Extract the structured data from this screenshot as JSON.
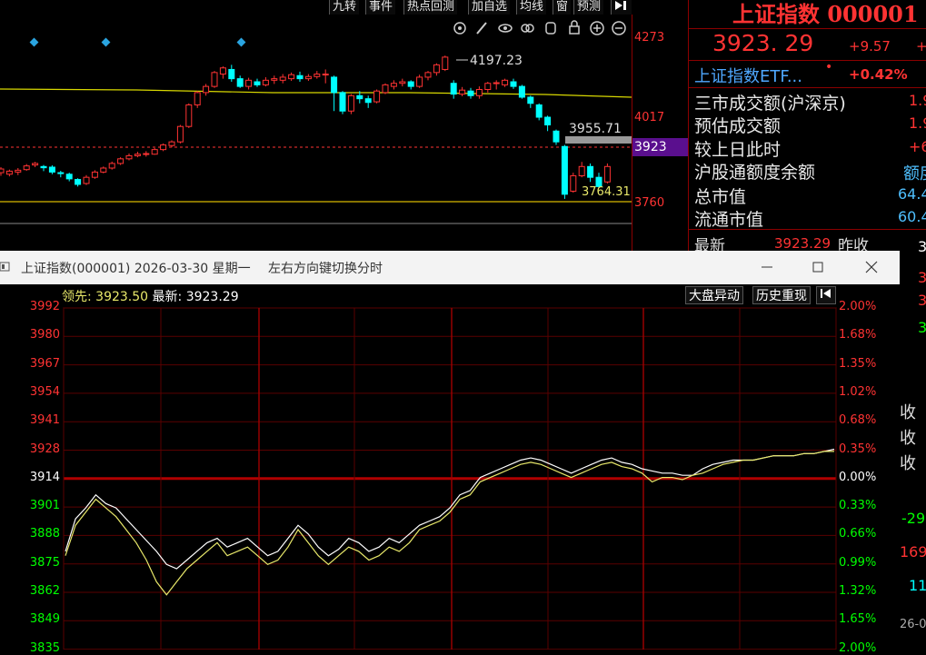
{
  "toolbar": {
    "items": [
      "九转",
      "事件",
      "热点回测",
      "加自选",
      "均线",
      "窗",
      "预测"
    ]
  },
  "kline": {
    "high_label": "4197.23",
    "low_label": "3764.31",
    "recent_label": "3955.71",
    "axis_labels": [
      "4273",
      "4017",
      "3760"
    ],
    "current_axis": "3923",
    "candles": [
      [
        3860,
        3872,
        3850,
        3878
      ],
      [
        3855,
        3865,
        3848,
        3870
      ],
      [
        3862,
        3868,
        3852,
        3875
      ],
      [
        3870,
        3882,
        3866,
        3888
      ],
      [
        3885,
        3890,
        3878,
        3895
      ],
      [
        3880,
        3876,
        3865,
        3885
      ],
      [
        3878,
        3862,
        3855,
        3884
      ],
      [
        3860,
        3858,
        3845,
        3866
      ],
      [
        3855,
        3840,
        3832,
        3860
      ],
      [
        3838,
        3822,
        3815,
        3842
      ],
      [
        3825,
        3845,
        3820,
        3852
      ],
      [
        3845,
        3862,
        3840,
        3868
      ],
      [
        3862,
        3875,
        3858,
        3880
      ],
      [
        3875,
        3890,
        3870,
        3896
      ],
      [
        3890,
        3905,
        3885,
        3910
      ],
      [
        3905,
        3915,
        3900,
        3922
      ],
      [
        3915,
        3920,
        3910,
        3928
      ],
      [
        3920,
        3922,
        3912,
        3930
      ],
      [
        3920,
        3935,
        3918,
        3940
      ],
      [
        3935,
        3950,
        3930,
        3955
      ],
      [
        3948,
        3960,
        3942,
        3965
      ],
      [
        3960,
        4010,
        3955,
        4015
      ],
      [
        4010,
        4080,
        4005,
        4085
      ],
      [
        4080,
        4120,
        4070,
        4125
      ],
      [
        4120,
        4140,
        4110,
        4148
      ],
      [
        4140,
        4185,
        4135,
        4190
      ],
      [
        4180,
        4200,
        4165,
        4205
      ],
      [
        4195,
        4165,
        4155,
        4210
      ],
      [
        4165,
        4140,
        4135,
        4175
      ],
      [
        4140,
        4160,
        4130,
        4168
      ],
      [
        4155,
        4145,
        4138,
        4165
      ],
      [
        4145,
        4160,
        4140,
        4170
      ],
      [
        4160,
        4165,
        4148,
        4175
      ],
      [
        4160,
        4170,
        4150,
        4180
      ],
      [
        4165,
        4178,
        4158,
        4185
      ],
      [
        4175,
        4165,
        4155,
        4188
      ],
      [
        4165,
        4172,
        4158,
        4180
      ],
      [
        4172,
        4180,
        4165,
        4190
      ],
      [
        4180,
        4180,
        4150,
        4195
      ],
      [
        4170,
        4120,
        4060,
        4175
      ],
      [
        4120,
        4060,
        4050,
        4125
      ],
      [
        4060,
        4110,
        4050,
        4115
      ],
      [
        4110,
        4100,
        4085,
        4125
      ],
      [
        4100,
        4088,
        4070,
        4110
      ],
      [
        4090,
        4125,
        4085,
        4130
      ],
      [
        4120,
        4145,
        4115,
        4150
      ],
      [
        4140,
        4150,
        4130,
        4160
      ],
      [
        4150,
        4155,
        4140,
        4165
      ],
      [
        4155,
        4140,
        4130,
        4160
      ],
      [
        4140,
        4170,
        4135,
        4178
      ],
      [
        4170,
        4185,
        4160,
        4190
      ],
      [
        4185,
        4210,
        4175,
        4215
      ],
      [
        4195,
        4235,
        4190,
        4240
      ],
      [
        4150,
        4115,
        4100,
        4160
      ],
      [
        4115,
        4128,
        4108,
        4138
      ],
      [
        4125,
        4110,
        4100,
        4135
      ],
      [
        4110,
        4130,
        4100,
        4140
      ],
      [
        4130,
        4150,
        4120,
        4155
      ],
      [
        4150,
        4152,
        4130,
        4160
      ],
      [
        4145,
        4160,
        4138,
        4165
      ],
      [
        4155,
        4140,
        4132,
        4165
      ],
      [
        4140,
        4105,
        4100,
        4145
      ],
      [
        4105,
        4085,
        4070,
        4110
      ],
      [
        4080,
        4040,
        4030,
        4085
      ],
      [
        4040,
        4015,
        3995,
        4045
      ],
      [
        3995,
        3960,
        3950,
        4000
      ],
      [
        3945,
        3790,
        3775,
        3950
      ],
      [
        3800,
        3850,
        3795,
        3860
      ],
      [
        3850,
        3880,
        3845,
        3895
      ],
      [
        3880,
        3845,
        3830,
        3890
      ],
      [
        3845,
        3815,
        3810,
        3860
      ],
      [
        3830,
        3880,
        3825,
        3890
      ]
    ]
  },
  "info": {
    "title": "上证指数 000001",
    "price": "3923. 29",
    "change": "+9.57",
    "change_partial": "+",
    "etf_name": "上证指数ETF...",
    "etf_dot": "•",
    "etf_pct": "+0.42%",
    "rows": [
      {
        "label": "三市成交额(沪深京)",
        "value": "1.9"
      },
      {
        "label": "预估成交额",
        "value": "1.9"
      },
      {
        "label": "较上日此时",
        "value": "+6"
      },
      {
        "label": "沪股通额度余额",
        "value": "额度"
      },
      {
        "label": "总市值",
        "value": "64.4"
      },
      {
        "label": "流通市值",
        "value": "60.4"
      }
    ],
    "latest_label": "最新",
    "latest_value": "3923.29",
    "prev_close_label": "昨收"
  },
  "window": {
    "title": "上证指数(000001) 2026-03-30 星期一",
    "hint": "左右方向键切换分时",
    "lead_label": "领先:",
    "lead_value": "3923.50",
    "latest_label": "最新:",
    "latest_value": "3923.29",
    "btn_abnormal": "大盘异动",
    "btn_replay": "历史重现",
    "left_labels": [
      "3992",
      "3980",
      "3967",
      "3954",
      "3941",
      "3928",
      "3914",
      "3901",
      "3888",
      "3875",
      "3862",
      "3849",
      "3835"
    ],
    "right_labels": [
      "2.00%",
      "1.68%",
      "1.35%",
      "1.02%",
      "0.68%",
      "0.35%",
      "0.00%",
      "0.33%",
      "0.66%",
      "0.99%",
      "1.32%",
      "1.65%",
      "2.00%"
    ]
  },
  "chart_data": {
    "type": "line",
    "title": "",
    "xlabel": "",
    "ylabel": "",
    "ylim": [
      3835,
      3992
    ],
    "baseline": 3914,
    "series": [
      {
        "name": "最新",
        "color": "#ffffff",
        "values": [
          3880,
          3895,
          3900,
          3906,
          3902,
          3900,
          3895,
          3890,
          3885,
          3880,
          3874,
          3872,
          3876,
          3880,
          3884,
          3886,
          3882,
          3884,
          3886,
          3882,
          3878,
          3880,
          3886,
          3892,
          3888,
          3882,
          3878,
          3881,
          3886,
          3884,
          3880,
          3882,
          3886,
          3884,
          3888,
          3892,
          3894,
          3896,
          3900,
          3906,
          3908,
          3914,
          3916,
          3918,
          3920,
          3922,
          3923,
          3922,
          3920,
          3918,
          3916,
          3918,
          3920,
          3922,
          3923,
          3921,
          3920,
          3918,
          3917,
          3916,
          3916,
          3915,
          3915,
          3918,
          3920,
          3921,
          3922,
          3922,
          3922,
          3923,
          3924,
          3924,
          3924,
          3925,
          3925,
          3926,
          3927
        ]
      },
      {
        "name": "领先",
        "color": "#e8e86a",
        "values": [
          3878,
          3892,
          3898,
          3904,
          3900,
          3896,
          3890,
          3884,
          3876,
          3866,
          3860,
          3866,
          3872,
          3876,
          3880,
          3884,
          3878,
          3880,
          3882,
          3878,
          3874,
          3876,
          3882,
          3890,
          3884,
          3878,
          3874,
          3878,
          3882,
          3880,
          3876,
          3878,
          3882,
          3880,
          3884,
          3890,
          3892,
          3894,
          3898,
          3904,
          3906,
          3912,
          3914,
          3916,
          3918,
          3920,
          3921,
          3920,
          3918,
          3916,
          3914,
          3916,
          3918,
          3920,
          3921,
          3919,
          3918,
          3916,
          3912,
          3914,
          3914,
          3913,
          3915,
          3916,
          3918,
          3920,
          3921,
          3922,
          3922,
          3923,
          3924,
          3924,
          3924,
          3925,
          3925,
          3926,
          3926
        ]
      }
    ],
    "y_labels_left": [
      "3992",
      "3980",
      "3967",
      "3954",
      "3941",
      "3928",
      "3914",
      "3901",
      "3888",
      "3875",
      "3862",
      "3849",
      "3835"
    ],
    "y_labels_right": [
      "2.00%",
      "1.68%",
      "1.35%",
      "1.02%",
      "0.68%",
      "0.35%",
      "0.00%",
      "0.33%",
      "0.66%",
      "0.99%",
      "1.32%",
      "1.65%",
      "2.00%"
    ],
    "grid": true
  },
  "right_strip": {
    "values": [
      "3",
      "3",
      "3",
      "3",
      "收",
      "收",
      "收",
      "-29",
      "169",
      "11",
      "26-0"
    ]
  },
  "colors": {
    "up": "#ff3333",
    "down": "#00ffff",
    "grid": "#8b0000",
    "ma": "#d8d800",
    "axis_green": "#00ff00"
  }
}
